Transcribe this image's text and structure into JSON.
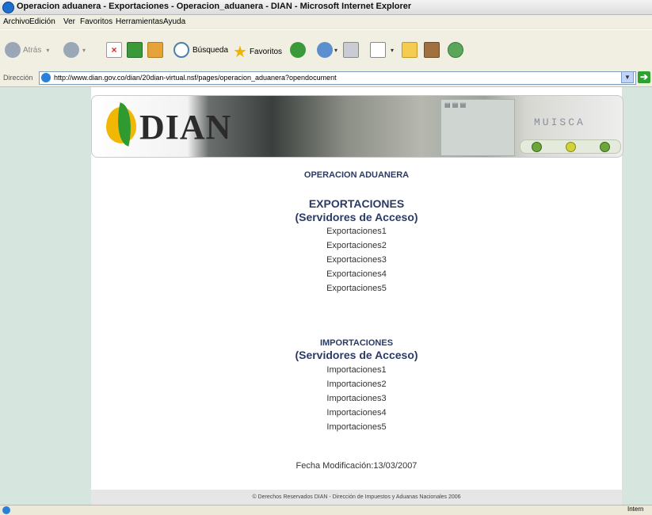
{
  "window": {
    "title": "Operacion aduanera - Exportaciones - Operacion_aduanera - DIAN - Microsoft Internet Explorer"
  },
  "menu": [
    "Archivo",
    "Edición",
    "Ver",
    "Favoritos",
    "Herramientas",
    "Ayuda"
  ],
  "toolbar": {
    "back_label": "Atrás",
    "search_label": "Búsqueda",
    "favorites_label": "Favoritos"
  },
  "address": {
    "label": "Dirección",
    "url": "http://www.dian.gov.co/dian/20dian-virtual.nsf/pages/operacion_aduanera?opendocument"
  },
  "banner": {
    "logo_text": "DIAN",
    "brand": "MUISCA"
  },
  "content": {
    "heading": "OPERACION ADUANERA",
    "export_title": "EXPORTACIONES",
    "export_subtitle": "(Servidores de Acceso)",
    "export_links": [
      "Exportaciones1",
      "Exportaciones2",
      "Exportaciones3",
      "Exportaciones4",
      "Exportaciones5"
    ],
    "import_title": "IMPORTACIONES",
    "import_subtitle": "(Servidores de Acceso)",
    "import_links": [
      "Importaciones1",
      "Importaciones2",
      "Importaciones3",
      "Importaciones4",
      "Importaciones5"
    ],
    "fecha": "Fecha Modificación:13/03/2007"
  },
  "footer": {
    "text": "© Derechos Reservados DIAN - Dirección de Impuestos y Aduanas Nacionales 2006"
  },
  "status": {
    "zone": "Intern"
  },
  "colors": {
    "heading": "#2b3a66",
    "page_bg": "#d6e6df"
  }
}
